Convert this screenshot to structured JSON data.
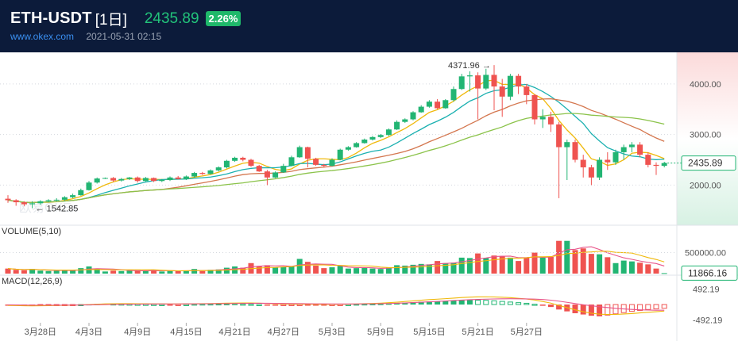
{
  "header": {
    "symbol": "ETH-USDT",
    "period": "[1日]",
    "price": "2435.89",
    "change": "2.26%",
    "site": "www.okex.com",
    "datetime": "2021-05-31 02:15"
  },
  "watermark": "欧易OKEx",
  "colors": {
    "up": "#22b573",
    "down": "#ef5350",
    "ma5": "#f0b90b",
    "ma10": "#1ab0b0",
    "ma20": "#d4764e",
    "ma30": "#8bc34a",
    "header_bg": "#0c1b3a"
  },
  "chart_data": {
    "type": "candlestick",
    "x_tick_labels": [
      "3月28日",
      "4月3日",
      "4月9日",
      "4月15日",
      "4月21日",
      "4月27日",
      "5月3日",
      "5月9日",
      "5月15日",
      "5月21日",
      "5月27日"
    ],
    "price_axis": {
      "ticks": [
        "4000.00",
        "3000.00",
        "2000.00"
      ],
      "range": [
        1300,
        4500
      ]
    },
    "last_price_label": "2435.89",
    "max_annotation": "4371.96",
    "min_annotation": "1542.85",
    "candles": [
      [
        1730,
        1700,
        1800,
        1650
      ],
      [
        1700,
        1660,
        1720,
        1590
      ],
      [
        1660,
        1620,
        1680,
        1580
      ],
      [
        1620,
        1640,
        1680,
        1542
      ],
      [
        1640,
        1680,
        1700,
        1610
      ],
      [
        1680,
        1700,
        1720,
        1660
      ],
      [
        1700,
        1710,
        1740,
        1680
      ],
      [
        1710,
        1760,
        1780,
        1690
      ],
      [
        1760,
        1800,
        1830,
        1740
      ],
      [
        1800,
        1900,
        1930,
        1790
      ],
      [
        1900,
        2050,
        2080,
        1890
      ],
      [
        2050,
        2130,
        2150,
        2030
      ],
      [
        2130,
        2140,
        2150,
        2120
      ],
      [
        2140,
        2090,
        2160,
        2060
      ],
      [
        2090,
        2120,
        2140,
        2070
      ],
      [
        2120,
        2150,
        2160,
        2100
      ],
      [
        2150,
        2080,
        2170,
        2050
      ],
      [
        2080,
        2140,
        2160,
        2070
      ],
      [
        2140,
        2080,
        2150,
        2060
      ],
      [
        2080,
        2100,
        2120,
        2060
      ],
      [
        2100,
        2150,
        2170,
        2080
      ],
      [
        2150,
        2120,
        2180,
        2110
      ],
      [
        2120,
        2170,
        2190,
        2100
      ],
      [
        2170,
        2240,
        2260,
        2150
      ],
      [
        2240,
        2220,
        2260,
        2200
      ],
      [
        2220,
        2290,
        2310,
        2210
      ],
      [
        2290,
        2350,
        2370,
        2270
      ],
      [
        2350,
        2480,
        2500,
        2330
      ],
      [
        2480,
        2540,
        2560,
        2460
      ],
      [
        2540,
        2500,
        2560,
        2470
      ],
      [
        2500,
        2380,
        2520,
        2360
      ],
      [
        2380,
        2270,
        2400,
        2260
      ],
      [
        2270,
        2150,
        2300,
        2000
      ],
      [
        2150,
        2250,
        2270,
        2140
      ],
      [
        2250,
        2380,
        2420,
        2240
      ],
      [
        2380,
        2550,
        2580,
        2370
      ],
      [
        2550,
        2750,
        2780,
        2540
      ],
      [
        2750,
        2520,
        2760,
        2350
      ],
      [
        2520,
        2400,
        2540,
        2380
      ],
      [
        2400,
        2380,
        2420,
        2350
      ],
      [
        2380,
        2500,
        2530,
        2370
      ],
      [
        2500,
        2700,
        2720,
        2490
      ],
      [
        2700,
        2750,
        2770,
        2680
      ],
      [
        2750,
        2830,
        2850,
        2740
      ],
      [
        2830,
        2900,
        2920,
        2820
      ],
      [
        2900,
        2950,
        2970,
        2880
      ],
      [
        2950,
        2990,
        3010,
        2930
      ],
      [
        2990,
        3100,
        3120,
        2970
      ],
      [
        3100,
        3250,
        3280,
        3090
      ],
      [
        3250,
        3300,
        3320,
        3230
      ],
      [
        3300,
        3440,
        3460,
        3280
      ],
      [
        3440,
        3550,
        3580,
        3430
      ],
      [
        3550,
        3650,
        3680,
        3530
      ],
      [
        3650,
        3520,
        3700,
        3500
      ],
      [
        3520,
        3680,
        3700,
        3510
      ],
      [
        3680,
        3900,
        3950,
        3650
      ],
      [
        3900,
        4150,
        4200,
        3880
      ],
      [
        4150,
        4170,
        4250,
        3850
      ],
      [
        4170,
        3910,
        4230,
        3300
      ],
      [
        3910,
        4180,
        4300,
        3880
      ],
      [
        4180,
        3950,
        4371.96,
        3480
      ],
      [
        3950,
        3750,
        4100,
        3350
      ],
      [
        3750,
        4160,
        4200,
        3680
      ],
      [
        4160,
        3950,
        4200,
        3800
      ],
      [
        3950,
        3780,
        4000,
        3600
      ],
      [
        3780,
        3300,
        3800,
        3200
      ],
      [
        3300,
        3350,
        3500,
        3130
      ],
      [
        3350,
        3200,
        3450,
        3050
      ],
      [
        3200,
        2750,
        3250,
        1740
      ],
      [
        2750,
        2850,
        2900,
        2100
      ],
      [
        2850,
        2500,
        2900,
        2450
      ],
      [
        2500,
        2350,
        2600,
        2150
      ],
      [
        2350,
        2150,
        2400,
        2000
      ],
      [
        2150,
        2500,
        2550,
        2100
      ],
      [
        2500,
        2450,
        2650,
        2300
      ],
      [
        2450,
        2650,
        2700,
        2400
      ],
      [
        2650,
        2750,
        2800,
        2500
      ],
      [
        2750,
        2800,
        2850,
        2650
      ],
      [
        2800,
        2600,
        2850,
        2550
      ],
      [
        2600,
        2400,
        2650,
        2350
      ],
      [
        2400,
        2380,
        2450,
        2200
      ],
      [
        2380,
        2435.89,
        2460,
        2350
      ]
    ],
    "volume_label": "VOLUME(5,10)",
    "volume_axis_tick": "500000.00",
    "volume_current_label": "11866.16",
    "volume_range": [
      0,
      850000
    ],
    "volumes": [
      120000,
      90000,
      80000,
      110000,
      70000,
      60000,
      65000,
      80000,
      90000,
      130000,
      170000,
      120000,
      50000,
      70000,
      60000,
      70000,
      80000,
      60000,
      90000,
      50000,
      70000,
      60000,
      70000,
      110000,
      60000,
      90000,
      100000,
      140000,
      170000,
      140000,
      250000,
      180000,
      200000,
      150000,
      160000,
      170000,
      350000,
      280000,
      190000,
      130000,
      150000,
      180000,
      120000,
      130000,
      140000,
      120000,
      110000,
      150000,
      200000,
      190000,
      210000,
      230000,
      220000,
      300000,
      250000,
      260000,
      380000,
      370000,
      480000,
      370000,
      430000,
      420000,
      380000,
      300000,
      380000,
      500000,
      380000,
      400000,
      780000,
      780000,
      560000,
      600000,
      470000,
      460000,
      390000,
      250000,
      310000,
      290000,
      260000,
      220000,
      120000,
      11866.16
    ],
    "macd_label": "MACD(12,26,9)",
    "macd_axis_ticks": [
      "492.19",
      "-492.19"
    ],
    "macd_range": [
      -560,
      560
    ],
    "macd_hist": [
      -20,
      -25,
      -30,
      -30,
      -25,
      -20,
      -15,
      -10,
      -5,
      0,
      10,
      20,
      25,
      22,
      18,
      15,
      10,
      8,
      5,
      0,
      -5,
      -3,
      0,
      5,
      8,
      10,
      12,
      15,
      18,
      15,
      10,
      0,
      -15,
      -20,
      -15,
      -10,
      -5,
      -8,
      -10,
      -12,
      -10,
      -5,
      0,
      5,
      10,
      15,
      20,
      30,
      45,
      60,
      75,
      90,
      100,
      100,
      110,
      125,
      140,
      150,
      140,
      135,
      120,
      100,
      80,
      60,
      40,
      10,
      -40,
      -80,
      -160,
      -220,
      -280,
      -320,
      -360,
      -380,
      -340,
      -300,
      -260,
      -220,
      -190,
      -160,
      -140,
      -120
    ],
    "macd_dif": [
      -30,
      -35,
      -40,
      -42,
      -40,
      -36,
      -30,
      -24,
      -18,
      -10,
      0,
      10,
      20,
      25,
      26,
      26,
      25,
      24,
      22,
      20,
      18,
      18,
      20,
      24,
      28,
      32,
      36,
      42,
      48,
      50,
      50,
      44,
      34,
      25,
      18,
      14,
      12,
      10,
      8,
      6,
      6,
      8,
      12,
      18,
      26,
      34,
      44,
      58,
      76,
      96,
      116,
      138,
      158,
      172,
      188,
      206,
      224,
      238,
      246,
      248,
      244,
      234,
      220,
      200,
      176,
      144,
      98,
      44,
      -30,
      -100,
      -170,
      -230,
      -280,
      -310,
      -320,
      -318,
      -305,
      -290,
      -270,
      -250,
      -230,
      -210
    ],
    "macd_dea": [
      -10,
      -15,
      -18,
      -20,
      -22,
      -22,
      -21,
      -19,
      -17,
      -14,
      -10,
      -6,
      -2,
      3,
      7,
      10,
      13,
      15,
      17,
      18,
      19,
      19,
      20,
      21,
      22,
      24,
      26,
      28,
      32,
      35,
      38,
      40,
      39,
      37,
      34,
      31,
      28,
      25,
      22,
      20,
      18,
      17,
      17,
      18,
      20,
      22,
      26,
      32,
      40,
      50,
      62,
      75,
      88,
      101,
      114,
      128,
      142,
      154,
      164,
      172,
      178,
      183,
      185,
      184,
      181,
      174,
      160,
      140,
      108,
      70,
      30,
      -6,
      -40,
      -70,
      -98,
      -122,
      -142,
      -158,
      -170,
      -178,
      -182,
      -184
    ]
  }
}
